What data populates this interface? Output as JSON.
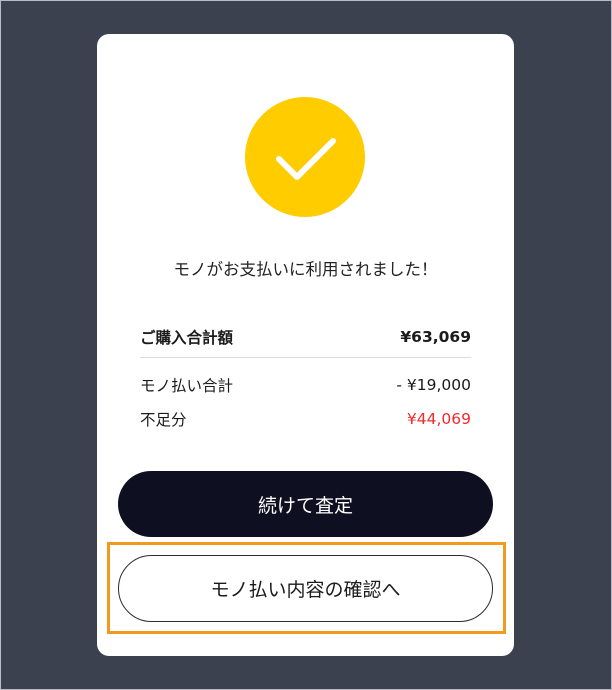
{
  "modal": {
    "message": "モノがお支払いに利用されました！",
    "summary": {
      "total_label": "ご購入合計額",
      "total_value": "¥63,069",
      "mono_label": "モノ払い合計",
      "mono_value": "- ¥19,000",
      "shortage_label": "不足分",
      "shortage_value": "¥44,069"
    },
    "buttons": {
      "continue_label": "続けて査定",
      "confirm_label": "モノ払い内容の確認へ"
    }
  },
  "colors": {
    "backdrop": "#3c4150",
    "check_circle": "#ffcc00",
    "primary_button": "#0e1021",
    "shortage_text": "#f22a2a",
    "highlight": "#f29a1e"
  },
  "icons": {
    "success": "checkmark-icon"
  }
}
